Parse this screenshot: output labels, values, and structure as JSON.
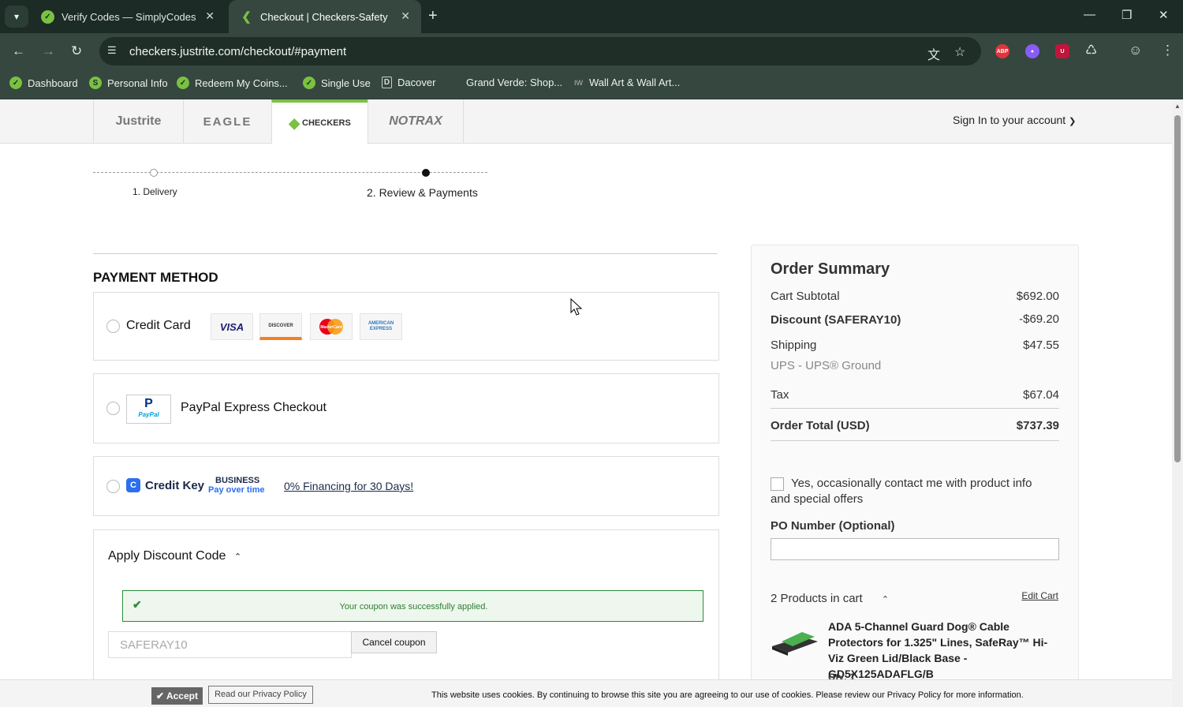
{
  "browser": {
    "tabs": [
      {
        "title": "Verify Codes — SimplyCodes",
        "active": false
      },
      {
        "title": "Checkout | Checkers-Safety",
        "active": true
      }
    ],
    "url": "checkers.justrite.com/checkout/#payment",
    "bookmarks": [
      "Dashboard",
      "Personal Info",
      "Redeem My Coins...",
      "Single Use",
      "Dacover",
      "Grand Verde: Shop...",
      "Wall Art & Wall Art..."
    ],
    "ext_abp": "ABP"
  },
  "brands": [
    "Justrite",
    "EAGLE",
    "CHECKERS",
    "NOTRAX"
  ],
  "header": {
    "signin": "Sign In to your account"
  },
  "steps": [
    {
      "label": "1. Delivery"
    },
    {
      "label": "2. Review & Payments"
    }
  ],
  "payment": {
    "heading": "PAYMENT METHOD",
    "credit_card": {
      "label": "Credit Card",
      "logos": [
        "VISA",
        "DISCOVER",
        "MasterCard",
        "AMERICAN EXPRESS"
      ]
    },
    "paypal": {
      "label": "PayPal Express Checkout",
      "logo": "PayPal"
    },
    "creditkey": {
      "brand": "Credit Key",
      "business": "BUSINESS",
      "tagline": "Pay over time",
      "link": "0% Financing for 30 Days!"
    }
  },
  "discount": {
    "title": "Apply Discount Code",
    "success": "Your coupon was successfully applied.",
    "code": "SAFERAY10",
    "cancel": "Cancel coupon"
  },
  "summary": {
    "title": "Order Summary",
    "subtotal_label": "Cart Subtotal",
    "subtotal": "$692.00",
    "discount_label": "Discount (SAFERAY10)",
    "discount": "-$69.20",
    "shipping_label": "Shipping",
    "shipping": "$47.55",
    "shipping_method": "UPS - UPS® Ground",
    "tax_label": "Tax",
    "tax": "$67.04",
    "total_label": "Order Total (USD)",
    "total": "$737.39",
    "contact_opt": "Yes, occasionally contact me with product info and special offers",
    "po_label": "PO Number (Optional)",
    "products_count": "2 Products in cart",
    "edit_cart": "Edit Cart",
    "product_name": "ADA 5-Channel Guard Dog® Cable Protectors for 1.325\" Lines, SafeRay™ Hi-Viz Green Lid/Black Base - GD5X125ADAFLG/B",
    "product_qty": "Qty: 1"
  },
  "cookie": {
    "accept": "Accept",
    "policy": "Read our Privacy Policy",
    "message": "This website uses cookies. By continuing to browse this site you are agreeing to our use of cookies. Please review our Privacy Policy for more information."
  }
}
